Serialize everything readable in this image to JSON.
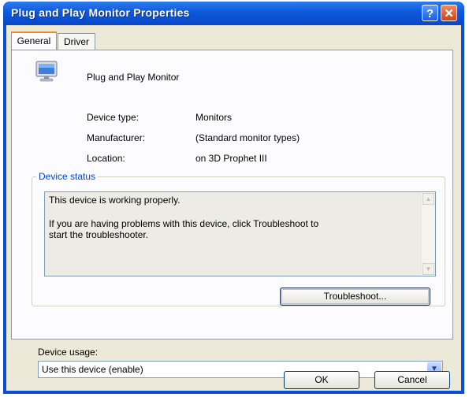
{
  "window": {
    "title": "Plug and Play Monitor Properties",
    "help_label": "?",
    "close_label": "✕"
  },
  "tabs": [
    {
      "label": "General"
    },
    {
      "label": "Driver"
    }
  ],
  "device": {
    "name": "Plug and Play Monitor",
    "icon": "monitor-icon",
    "props": [
      {
        "label": "Device type:",
        "value": "Monitors"
      },
      {
        "label": "Manufacturer:",
        "value": "(Standard monitor types)"
      },
      {
        "label": "Location:",
        "value": "on 3D Prophet III"
      }
    ]
  },
  "status": {
    "group_label": "Device status",
    "line1": "This device is working properly.",
    "line2": "If you are having problems with this device, click Troubleshoot to",
    "line3": "start the troubleshooter.",
    "troubleshoot_label": "Troubleshoot..."
  },
  "usage": {
    "label": "Device usage:",
    "selected": "Use this device (enable)"
  },
  "footer": {
    "ok_label": "OK",
    "cancel_label": "Cancel"
  },
  "colors": {
    "titlebar": "#0848c8",
    "group_label": "#0046d5",
    "dialog_face": "#ece9d8"
  }
}
